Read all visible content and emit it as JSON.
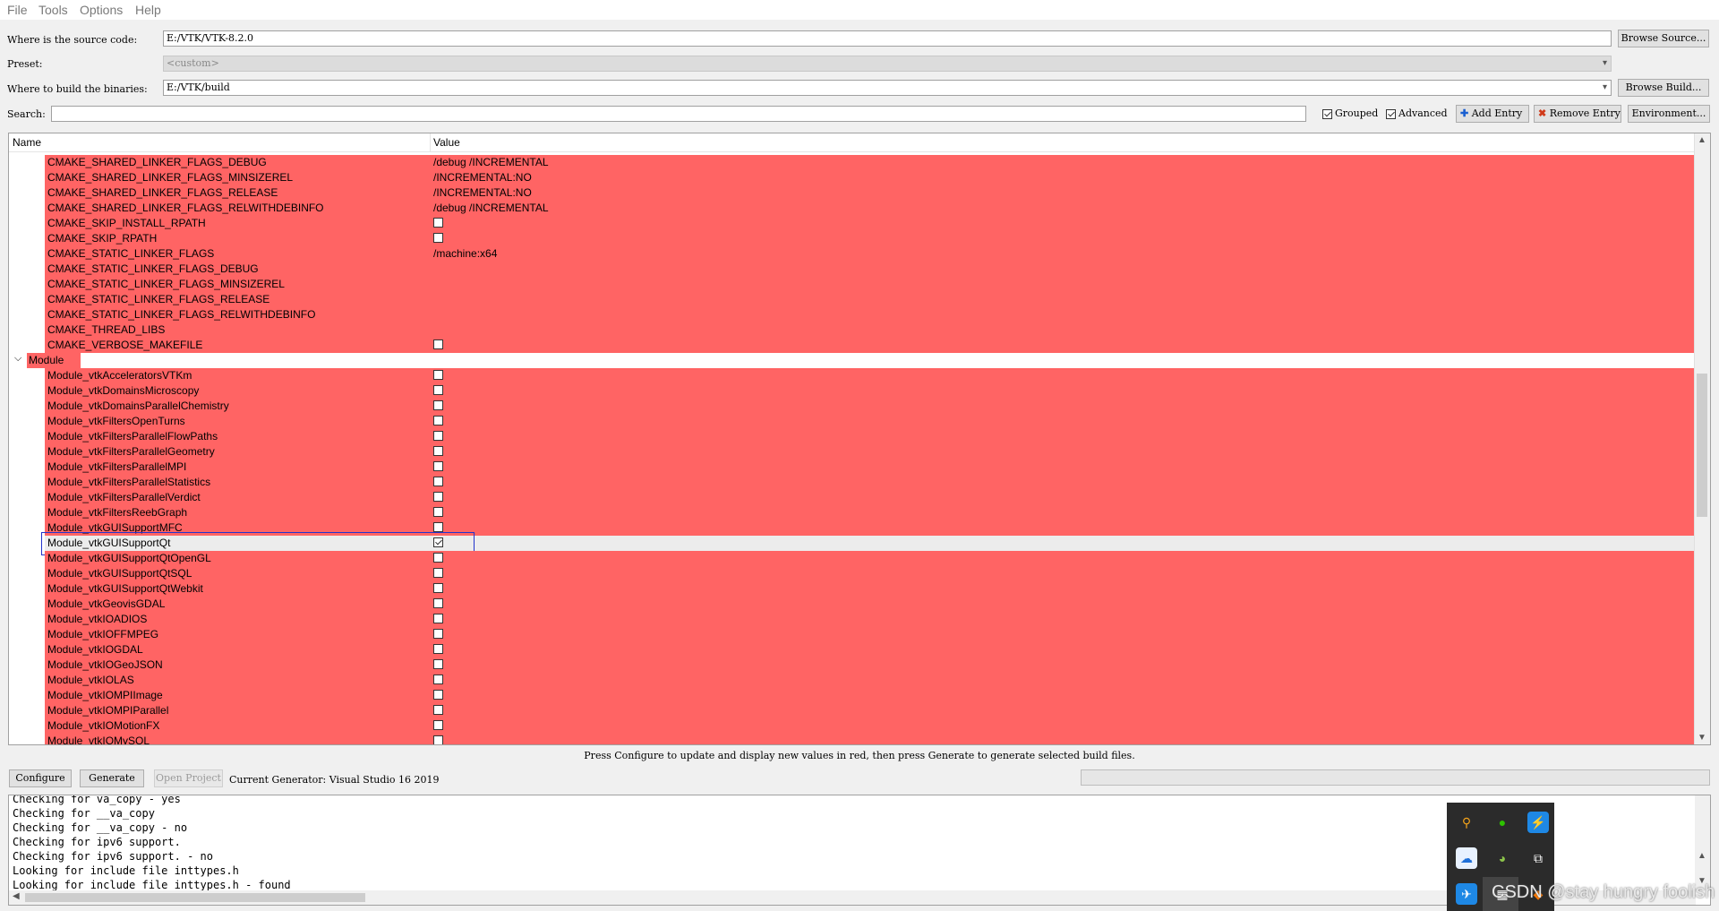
{
  "menu": [
    "File",
    "Tools",
    "Options",
    "Help"
  ],
  "source": {
    "label": "Where is the source code:",
    "value": "E:/VTK/VTK-8.2.0",
    "browse": "Browse Source..."
  },
  "preset": {
    "label": "Preset:",
    "value": "<custom>"
  },
  "build": {
    "label": "Where to build the binaries:",
    "value": "E:/VTK/build",
    "browse": "Browse Build..."
  },
  "search": {
    "label": "Search:",
    "value": ""
  },
  "options": {
    "grouped": "Grouped",
    "advanced": "Advanced",
    "add_entry": "Add Entry",
    "remove_entry": "Remove Entry",
    "environment": "Environment..."
  },
  "table": {
    "col_name": "Name",
    "col_value": "Value",
    "rows": [
      {
        "name": "CMAKE_SHARED_LINKER_FLAGS_DEBUG",
        "value": "/debug /INCREMENTAL",
        "type": "text"
      },
      {
        "name": "CMAKE_SHARED_LINKER_FLAGS_MINSIZEREL",
        "value": "/INCREMENTAL:NO",
        "type": "text"
      },
      {
        "name": "CMAKE_SHARED_LINKER_FLAGS_RELEASE",
        "value": "/INCREMENTAL:NO",
        "type": "text"
      },
      {
        "name": "CMAKE_SHARED_LINKER_FLAGS_RELWITHDEBINFO",
        "value": "/debug /INCREMENTAL",
        "type": "text"
      },
      {
        "name": "CMAKE_SKIP_INSTALL_RPATH",
        "value": "",
        "type": "bool",
        "checked": false
      },
      {
        "name": "CMAKE_SKIP_RPATH",
        "value": "",
        "type": "bool",
        "checked": false
      },
      {
        "name": "CMAKE_STATIC_LINKER_FLAGS",
        "value": "/machine:x64",
        "type": "text"
      },
      {
        "name": "CMAKE_STATIC_LINKER_FLAGS_DEBUG",
        "value": "",
        "type": "text"
      },
      {
        "name": "CMAKE_STATIC_LINKER_FLAGS_MINSIZEREL",
        "value": "",
        "type": "text"
      },
      {
        "name": "CMAKE_STATIC_LINKER_FLAGS_RELEASE",
        "value": "",
        "type": "text"
      },
      {
        "name": "CMAKE_STATIC_LINKER_FLAGS_RELWITHDEBINFO",
        "value": "",
        "type": "text"
      },
      {
        "name": "CMAKE_THREAD_LIBS",
        "value": "",
        "type": "text"
      },
      {
        "name": "CMAKE_VERBOSE_MAKEFILE",
        "value": "",
        "type": "bool",
        "checked": false
      },
      {
        "name": "Module",
        "type": "group"
      },
      {
        "name": "Module_vtkAcceleratorsVTKm",
        "type": "bool",
        "checked": false
      },
      {
        "name": "Module_vtkDomainsMicroscopy",
        "type": "bool",
        "checked": false
      },
      {
        "name": "Module_vtkDomainsParallelChemistry",
        "type": "bool",
        "checked": false
      },
      {
        "name": "Module_vtkFiltersOpenTurns",
        "type": "bool",
        "checked": false
      },
      {
        "name": "Module_vtkFiltersParallelFlowPaths",
        "type": "bool",
        "checked": false
      },
      {
        "name": "Module_vtkFiltersParallelGeometry",
        "type": "bool",
        "checked": false
      },
      {
        "name": "Module_vtkFiltersParallelMPI",
        "type": "bool",
        "checked": false
      },
      {
        "name": "Module_vtkFiltersParallelStatistics",
        "type": "bool",
        "checked": false
      },
      {
        "name": "Module_vtkFiltersParallelVerdict",
        "type": "bool",
        "checked": false
      },
      {
        "name": "Module_vtkFiltersReebGraph",
        "type": "bool",
        "checked": false
      },
      {
        "name": "Module_vtkGUISupportMFC",
        "type": "bool",
        "checked": false
      },
      {
        "name": "Module_vtkGUISupportQt",
        "type": "bool",
        "checked": true,
        "selected": true
      },
      {
        "name": "Module_vtkGUISupportQtOpenGL",
        "type": "bool",
        "checked": false
      },
      {
        "name": "Module_vtkGUISupportQtSQL",
        "type": "bool",
        "checked": false
      },
      {
        "name": "Module_vtkGUISupportQtWebkit",
        "type": "bool",
        "checked": false
      },
      {
        "name": "Module_vtkGeovisGDAL",
        "type": "bool",
        "checked": false
      },
      {
        "name": "Module_vtkIOADIOS",
        "type": "bool",
        "checked": false
      },
      {
        "name": "Module_vtkIOFFMPEG",
        "type": "bool",
        "checked": false
      },
      {
        "name": "Module_vtkIOGDAL",
        "type": "bool",
        "checked": false
      },
      {
        "name": "Module_vtkIOGeoJSON",
        "type": "bool",
        "checked": false
      },
      {
        "name": "Module_vtkIOLAS",
        "type": "bool",
        "checked": false
      },
      {
        "name": "Module_vtkIOMPIImage",
        "type": "bool",
        "checked": false
      },
      {
        "name": "Module_vtkIOMPIParallel",
        "type": "bool",
        "checked": false
      },
      {
        "name": "Module_vtkIOMotionFX",
        "type": "bool",
        "checked": false
      },
      {
        "name": "Module_vtkIOMySQL",
        "type": "bool",
        "checked": false
      }
    ]
  },
  "hint": "Press Configure to update and display new values in red, then press Generate to generate selected build files.",
  "buttons": {
    "configure": "Configure",
    "generate": "Generate",
    "open_project": "Open Project"
  },
  "generator": "Current Generator: Visual Studio 16 2019",
  "log": [
    "Checking for va_copy - yes",
    "Checking for __va_copy",
    "Checking for __va_copy - no",
    "Checking for ipv6 support.",
    "Checking for ipv6 support. - no",
    "Looking for include file inttypes.h",
    "Looking for include file inttypes.h - found"
  ],
  "watermark": "CSDN @stay hungry foolish",
  "colors": {
    "changed_row": "#ff6464",
    "selection_border": "#2233cc"
  }
}
